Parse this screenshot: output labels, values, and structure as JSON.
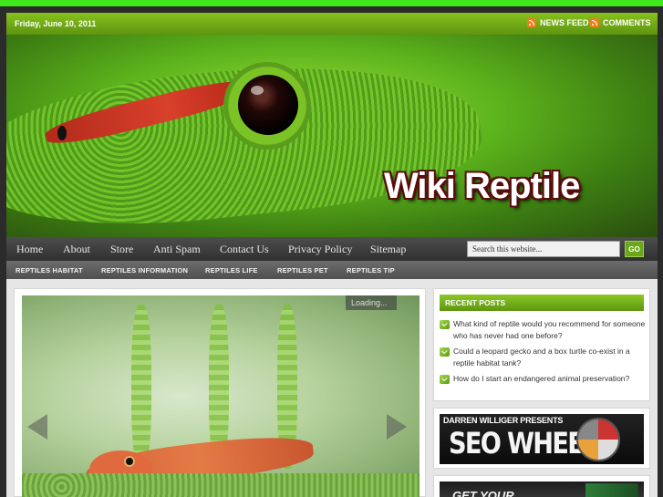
{
  "topbar": {
    "date": "Friday, June 10, 2011",
    "news_feed": "NEWS FEED",
    "comments": "COMMENTS"
  },
  "header": {
    "site_title": "Wiki Reptile"
  },
  "main_nav": {
    "items": [
      "Home",
      "About",
      "Store",
      "Anti Spam",
      "Contact Us",
      "Privacy Policy",
      "Sitemap"
    ],
    "search_value": "Search this website...",
    "go_label": "GO"
  },
  "sub_nav": {
    "items": [
      "REPTILES HABITAT",
      "REPTILES INFORMATION",
      "REPTILES LIFE",
      "REPTILES PET",
      "REPTILES TIP"
    ]
  },
  "slider": {
    "loading": "Loading..."
  },
  "sidebar": {
    "recent_title": "RECENT POSTS",
    "posts": [
      "What kind of reptile would you recommend for someone who has never had one before?",
      "Could a leopard gecko and a box turtle co-exist in a reptile habitat tank?",
      "How do I start an endangered animal preservation?"
    ],
    "ad1_top": "DARREN WILLIGER PRESENTS",
    "ad1_main": "SEO WHEEL",
    "ad2_text": "GET YOUR"
  },
  "colors": {
    "accent_green": "#6aa81a",
    "band_green": "#3ee81a",
    "rss_orange": "#ef7e1a"
  }
}
